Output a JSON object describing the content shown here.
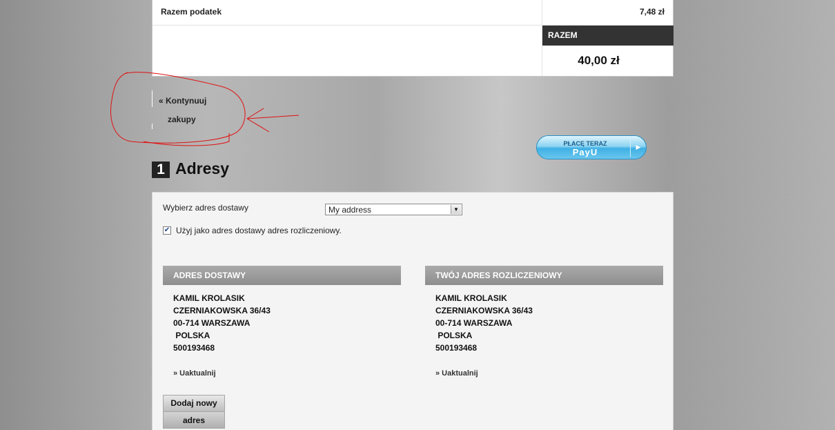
{
  "summary": {
    "tax_label": "Razem podatek",
    "tax_value": "7,48 zł",
    "total_label": "RAZEM",
    "total_value": "40,00 zł"
  },
  "continue_shopping": {
    "line1": "« Kontynuuj",
    "line2": "zakupy"
  },
  "payu": {
    "top_text": "PŁACĘ TERAZ",
    "logo_text": "PayU",
    "arrow": "▶"
  },
  "section": {
    "number": "1",
    "title": "Adresy"
  },
  "delivery_select": {
    "label": "Wybierz adres dostawy",
    "value": "My address",
    "arrow": "▼"
  },
  "same_address_checkbox": {
    "label": "Użyj jako adres dostawy adres rozliczeniowy.",
    "checked_mark": "✔"
  },
  "delivery_address": {
    "header": "ADRES DOSTAWY",
    "lines": [
      "KAMIL KROLASIK",
      "CZERNIAKOWSKA 36/43",
      "00-714 WARSZAWA",
      " POLSKA",
      "500193468"
    ],
    "update_link": "» Uaktualnij"
  },
  "billing_address": {
    "header": "TWÓJ ADRES ROZLICZENIOWY",
    "lines": [
      "KAMIL KROLASIK",
      "CZERNIAKOWSKA 36/43",
      "00-714 WARSZAWA",
      " POLSKA",
      "500193468"
    ],
    "update_link": "» Uaktualnij"
  },
  "add_new_button": {
    "line1": "Dodaj nowy",
    "line2": "adres"
  },
  "colors": {
    "annotation": "#e01010",
    "dark_header": "#333333"
  }
}
